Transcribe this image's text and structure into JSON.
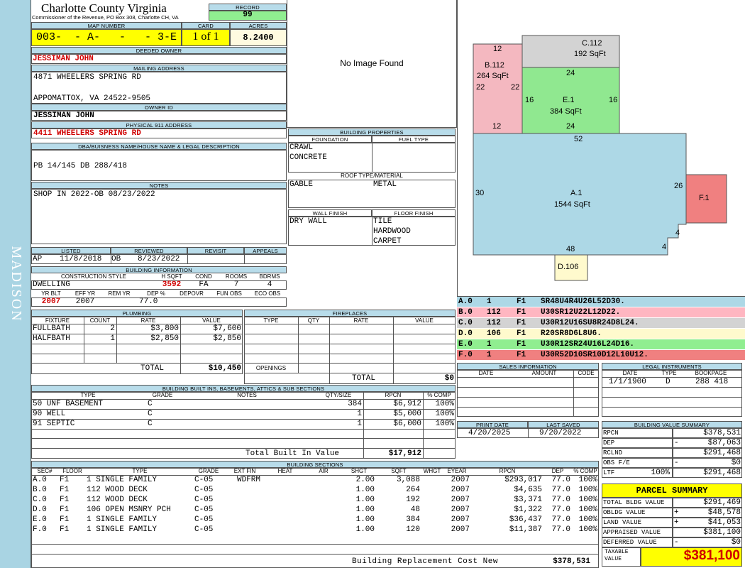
{
  "county": {
    "title": "Charlotte County Virginia",
    "subtitle": "Commissioner of the Revenue, PO Box 308, Charlotte CH, VA"
  },
  "side_label": "MADISON",
  "record": {
    "label": "RECORD",
    "value": "99"
  },
  "map": {
    "label": "MAP NUMBER",
    "value": "003-  - A-   -   - 3-E"
  },
  "card": {
    "label": "CARD",
    "value": "1 of 1"
  },
  "acres": {
    "label": "ACRES",
    "value": "8.2400"
  },
  "owner": {
    "label": "DEEDED OWNER",
    "value": "JESSIMAN JOHN"
  },
  "mailing": {
    "label": "MAILING ADDRESS",
    "line1": "4871 WHEELERS SPRING RD",
    "line2": "",
    "line3": "APPOMATTOX, VA 24522-9505"
  },
  "owner_id": {
    "label": "OWNER ID",
    "value": "JESSIMAN JOHN"
  },
  "physical": {
    "label": "PHYSICAL 911 ADDRESS",
    "value": "4411 WHEELERS SPRING RD"
  },
  "dba": {
    "label": "DBA/BUISNESS NAME/HOUSE NAME & LEGAL DESCRIPTION",
    "value": "PB 14/145 DB 288/418"
  },
  "notes": {
    "label": "NOTES",
    "value": "SHOP IN 2022-OB 08/23/2022"
  },
  "image": {
    "text": "No Image Found"
  },
  "bprops": {
    "label": "BUILDING PROPERTIES",
    "foundation_label": "FOUNDATION",
    "fuel_label": "FUEL TYPE",
    "foundation1": "CRAWL",
    "foundation2": "CONCRETE",
    "roof_label": "ROOF TYPE/MATERIAL",
    "roof_type": "GABLE",
    "roof_mat": "METAL",
    "wall_label": "WALL FINISH",
    "floor_label": "FLOOR FINISH",
    "wall": "DRY WALL",
    "floor1": "TILE",
    "floor2": "HARDWOOD",
    "floor3": "CARPET"
  },
  "listed": {
    "listed_label": "LISTED",
    "reviewed_label": "REVIEWED",
    "revisit_label": "REVISIT",
    "appeals_label": "APPEALS",
    "listed_by": "AP",
    "listed_date": "11/8/2018",
    "reviewed_by": "OB",
    "reviewed_date": "8/23/2022"
  },
  "binfo": {
    "label": "BUILDING INFORMATION",
    "style_label": "CONSTRUCTION STYLE",
    "hsqft_label": "H SQFT",
    "cond_label": "COND",
    "rooms_label": "ROOMS",
    "bdrms_label": "BDRMS",
    "style": "DWELLING",
    "hsqft": "3592",
    "cond": "FA",
    "rooms": "7",
    "bdrms": "4",
    "yrblt_label": "YR BLT",
    "effyr_label": "EFF YR",
    "remyr_label": "REM YR",
    "dep_label": "DEP %",
    "depovr_label": "DEPOVR",
    "funobs_label": "FUN OBS",
    "ecoobs_label": "ECO OBS",
    "yrblt": "2007",
    "effyr": "2007",
    "dep": "77.0"
  },
  "plumbing": {
    "label": "PLUMBING",
    "headers": [
      "FIXTURE",
      "COUNT",
      "RATE",
      "VALUE"
    ],
    "rows": [
      [
        "FULLBATH",
        "2",
        "$3,800",
        "$7,600"
      ],
      [
        "HALFBATH",
        "1",
        "$2,850",
        "$2,850"
      ]
    ],
    "total_label": "TOTAL",
    "total": "$10,450"
  },
  "fireplaces": {
    "label": "FIREPLACES",
    "headers": [
      "TYPE",
      "QTY",
      "RATE",
      "VALUE"
    ],
    "openings_label": "OPENINGS",
    "total_label": "TOTAL",
    "total": "$0"
  },
  "builtins": {
    "label": "BUILDING BUILT INS, BASEMENTS, ATTICS & SUB SECTIONS",
    "headers": [
      "TYPE",
      "GRADE",
      "NOTES",
      "QTY/SIZE",
      "RPCN",
      "% COMP"
    ],
    "rows": [
      [
        "50 UNF BASEMENT",
        "C",
        "",
        "384",
        "$6,912",
        "100%"
      ],
      [
        "90 WELL",
        "C",
        "",
        "1",
        "$5,000",
        "100%"
      ],
      [
        "91 SEPTIC",
        "C",
        "",
        "1",
        "$6,000",
        "100%"
      ]
    ],
    "total_label": "Total Built In Value",
    "total": "$17,912"
  },
  "sections": {
    "label": "BUILDING SECTIONS",
    "headers": [
      "SEC#",
      "FLOOR",
      "TYPE",
      "GRADE",
      "EXT FIN",
      "HEAT",
      "AIR",
      "SHGT",
      "SQFT",
      "WHGT",
      "EYEAR",
      "RPCN",
      "DEP",
      "% COMP"
    ],
    "rows": [
      [
        "A.0",
        "F1",
        "1 SINGLE FAMILY",
        "C-05",
        "WDFRM",
        "",
        "",
        "2.00",
        "3,088",
        "",
        "2007",
        "$293,017",
        "77.0",
        "100%"
      ],
      [
        "B.0",
        "F1",
        "112 WOOD DECK",
        "C-05",
        "",
        "",
        "",
        "1.00",
        "264",
        "",
        "2007",
        "$4,635",
        "77.0",
        "100%"
      ],
      [
        "C.0",
        "F1",
        "112 WOOD DECK",
        "C-05",
        "",
        "",
        "",
        "1.00",
        "192",
        "",
        "2007",
        "$3,371",
        "77.0",
        "100%"
      ],
      [
        "D.0",
        "F1",
        "106 OPEN MSNRY PCH",
        "C-05",
        "",
        "",
        "",
        "1.00",
        "48",
        "",
        "2007",
        "$1,322",
        "77.0",
        "100%"
      ],
      [
        "E.0",
        "F1",
        "1 SINGLE FAMILY",
        "C-05",
        "",
        "",
        "",
        "1.00",
        "384",
        "",
        "2007",
        "$36,437",
        "77.0",
        "100%"
      ],
      [
        "F.0",
        "F1",
        "1 SINGLE FAMILY",
        "C-05",
        "",
        "",
        "",
        "1.00",
        "120",
        "",
        "2007",
        "$11,387",
        "77.0",
        "100%"
      ]
    ],
    "total_label": "Building Replacement Cost New",
    "total": "$378,531"
  },
  "sketch": {
    "labels": [
      {
        "id": "C.112",
        "area": "192 SqFt"
      },
      {
        "id": "B.112",
        "area": "264 SqFt"
      },
      {
        "id": "E.1",
        "area": "384 SqFt"
      },
      {
        "id": "A.1",
        "area": "1544 SqFt"
      },
      {
        "id": "F.1"
      },
      {
        "id": "D.106"
      }
    ],
    "dims": [
      "12",
      "24",
      "22",
      "22",
      "16",
      "16",
      "12",
      "24",
      "52",
      "30",
      "26",
      "4",
      "48",
      "4"
    ],
    "colors": {
      "pink": "#f4b8c0",
      "gray": "#d3d3d3",
      "green": "#90e890",
      "blue": "#add8e6",
      "red": "#f08080",
      "cream": "#fffacd"
    }
  },
  "vectors": [
    {
      "code": "A.0",
      "num": "1",
      "fl": "F1",
      "vec": "SR48U4R4U26L52D30.",
      "color": "#add8e6"
    },
    {
      "code": "B.0",
      "num": "112",
      "fl": "F1",
      "vec": "U30SR12U22L12D22.",
      "color": "#ffb6c1"
    },
    {
      "code": "C.0",
      "num": "112",
      "fl": "F1",
      "vec": "U30R12U16SU8R24D8L24.",
      "color": "#d3d3d3"
    },
    {
      "code": "D.0",
      "num": "106",
      "fl": "F1",
      "vec": "R20SR8D6L8U6.",
      "color": "#fffacd"
    },
    {
      "code": "E.0",
      "num": "1",
      "fl": "F1",
      "vec": "U30R12SR24U16L24D16.",
      "color": "#90ee90"
    },
    {
      "code": "F.0",
      "num": "1",
      "fl": "F1",
      "vec": "U30R52D10SR10D12L10U12.",
      "color": "#f08080"
    }
  ],
  "sales": {
    "label": "SALES INFORMATION",
    "headers": [
      "DATE",
      "AMOUNT",
      "CODE"
    ]
  },
  "legal": {
    "label": "LEGAL INSTRUMENTS",
    "headers": [
      "DATE",
      "TYPE",
      "BOOKPAGE"
    ],
    "rows": [
      [
        "1/1/1900",
        "D",
        "288 418"
      ]
    ]
  },
  "print": {
    "print_label": "PRINT DATE",
    "saved_label": "LAST SAVED",
    "print_date": "4/20/2025",
    "saved_date": "9/20/2022"
  },
  "bvs": {
    "label": "BUILDING VALUE SUMMARY",
    "rows": [
      [
        "RPCN",
        "",
        "",
        "$378,531"
      ],
      [
        "DEP",
        "-",
        "",
        "$87,063"
      ],
      [
        "RCLND",
        "",
        "",
        "$291,468"
      ],
      [
        "OBS F/E",
        "-",
        "",
        "$0"
      ],
      [
        "LTF",
        "",
        "100%",
        "$291,468"
      ]
    ]
  },
  "parcel": {
    "label": "PARCEL SUMMARY",
    "rows": [
      [
        "TOTAL BLDG VALUE",
        "",
        "$291,469"
      ],
      [
        "OBLDG VALUE",
        "+",
        "$48,578"
      ],
      [
        "LAND VALUE",
        "+",
        "$41,053"
      ],
      [
        "APPRAISED VALUE",
        "",
        "$381,100"
      ],
      [
        "DEFERRED VALUE",
        "-",
        "$0"
      ]
    ],
    "taxable_label": "TAXABLE VALUE",
    "taxable": "$381,100"
  }
}
